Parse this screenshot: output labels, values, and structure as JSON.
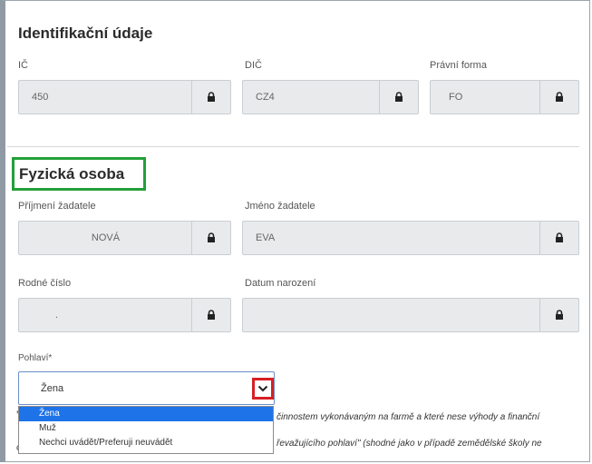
{
  "section_identification": {
    "title": "Identifikační údaje",
    "ic_label": "IČ",
    "ic_value": "450",
    "dic_label": "DIČ",
    "dic_value": "CZ4",
    "legal_form_label": "Právní forma",
    "legal_form_value": "FO"
  },
  "section_person": {
    "title": "Fyzická osoba",
    "surname_label": "Příjmení žadatele",
    "surname_value": "NOVÁ",
    "firstname_label": "Jméno žadatele",
    "firstname_value": "EVA",
    "birth_number_label": "Rodné číslo",
    "birth_number_value": ".",
    "birth_date_label": "Datum narození",
    "birth_date_value": "",
    "gender_label": "Pohlaví*",
    "gender_value": "Žena",
    "gender_options": [
      "Žena",
      "Muž",
      "Nechci uvádět/Preferuji neuvádět"
    ]
  },
  "notes": {
    "line1": "činnostem vykonávaným na farmě a které nese výhody a finanční",
    "line2": "řevažujícího pohlaví\" (shodné jako v případě zemědělské školy ne"
  },
  "stubs": {
    "line1": "*",
    "line2": "c"
  },
  "colors": {
    "highlight_green": "#23a03a",
    "highlight_red": "#d81f26",
    "selected_option": "#1e73e8"
  }
}
